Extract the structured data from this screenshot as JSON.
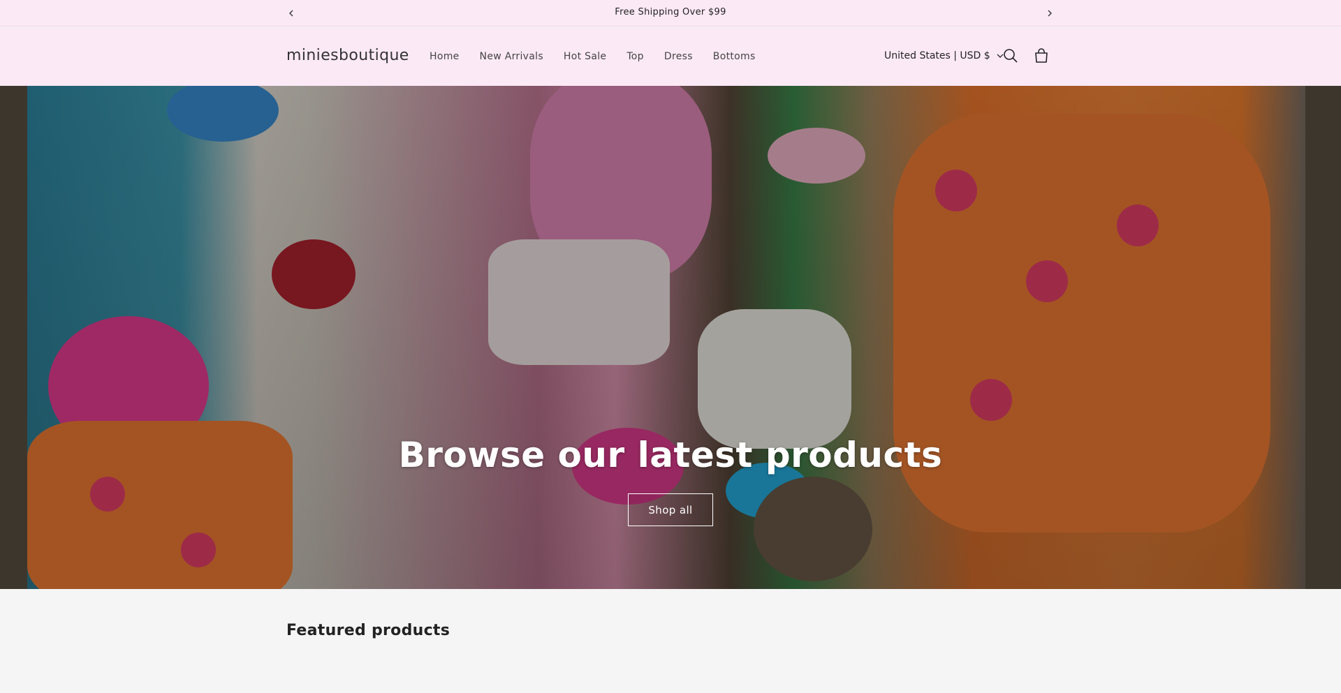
{
  "announcement": {
    "text": "Free Shipping Over $99",
    "prev_icon": "chevron-left-icon",
    "next_icon": "chevron-right-icon"
  },
  "header": {
    "logo": "miniesboutique",
    "nav": [
      "Home",
      "New Arrivals",
      "Hot Sale",
      "Top",
      "Dress",
      "Bottoms"
    ],
    "country_selector": "United States | USD $",
    "icons": [
      "search-icon",
      "cart-icon"
    ]
  },
  "hero": {
    "title": "Browse our latest products",
    "button_label": "Shop all"
  },
  "featured": {
    "heading": "Featured products"
  },
  "colors": {
    "header_bg": "#fce9f6",
    "page_bg": "#f5f5f5",
    "hero_frame": "#3d362c"
  }
}
